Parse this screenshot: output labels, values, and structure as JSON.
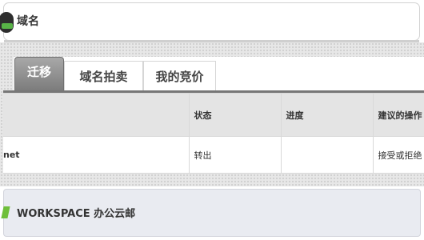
{
  "domain_panel": {
    "title": "域名",
    "icon": "domain-logo-icon"
  },
  "tabs": [
    {
      "label": "迁移",
      "active": true
    },
    {
      "label": "域名拍卖",
      "active": false
    },
    {
      "label": "我的竞价",
      "active": false
    }
  ],
  "table": {
    "columns": [
      "",
      "状态",
      "进度",
      "建议的操作"
    ],
    "rows": [
      {
        "name": "net",
        "status": "转出",
        "progress": "",
        "action": "接受或拒绝"
      }
    ]
  },
  "workspace_panel": {
    "title": "WORKSPACE 办公云邮",
    "icon": "workspace-logo-icon"
  },
  "colors": {
    "active_tab_top": "#a8a8a8",
    "active_tab_bottom": "#7c7c7c",
    "accent_green": "#58b347"
  }
}
